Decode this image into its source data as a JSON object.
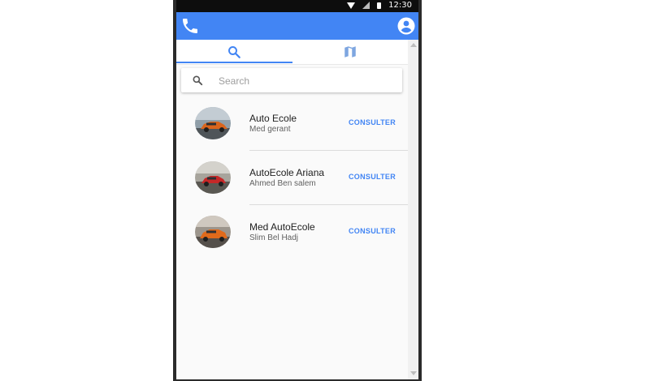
{
  "status_bar": {
    "time": "12:30",
    "icons": [
      "wifi-icon",
      "signal-icon",
      "battery-icon"
    ]
  },
  "app_bar": {
    "color": "#4285f4",
    "left_icon": "phone-icon",
    "right_icon": "account-circle-icon"
  },
  "tabs": [
    {
      "name": "search",
      "icon": "search-icon",
      "active": true
    },
    {
      "name": "map",
      "icon": "map-icon",
      "active": false
    }
  ],
  "search": {
    "placeholder": "Search",
    "value": ""
  },
  "contacts": [
    {
      "title": "Auto Ecole",
      "subtitle": "Med gerant",
      "action": "CONSULTER",
      "avatar": "orange-sports-car"
    },
    {
      "title": "AutoEcole Ariana",
      "subtitle": "Ahmed Ben salem",
      "action": "CONSULTER",
      "avatar": "red-sports-car"
    },
    {
      "title": "Med AutoEcole",
      "subtitle": "Slim Bel Hadj",
      "action": "CONSULTER",
      "avatar": "orange-sports-car"
    }
  ],
  "colors": {
    "accent": "#4285f4",
    "status_bar": "#0d0d0d",
    "text_primary": "#212121",
    "text_secondary": "#616161"
  }
}
